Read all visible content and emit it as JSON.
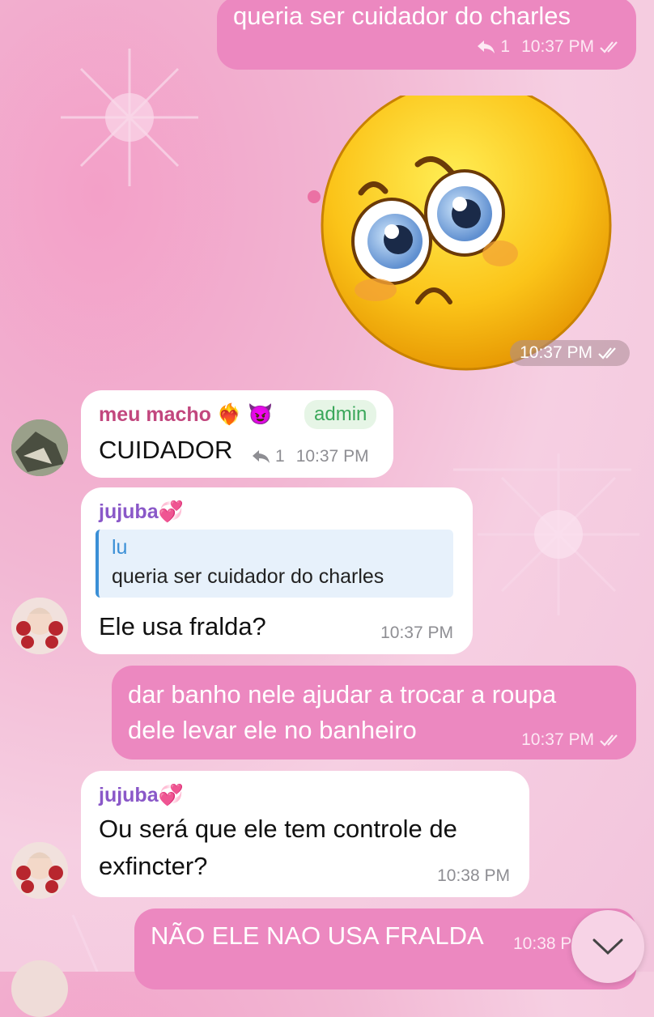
{
  "messages": [
    {
      "id": "m1",
      "text": "queria ser cuidador do charles",
      "replies": "1",
      "time": "10:37 PM"
    },
    {
      "id": "m2",
      "sticker": "pleading-face-sticker",
      "time": "10:37 PM"
    },
    {
      "id": "m3",
      "sender": "meu macho",
      "sender_emoji": "❤️‍🔥 😈",
      "badge": "admin",
      "text": "CUIDADOR",
      "replies": "1",
      "time": "10:37 PM"
    },
    {
      "id": "m4",
      "sender": "jujuba",
      "sender_emoji": "💞",
      "reply_name": "lu",
      "reply_text": "queria ser cuidador do charles",
      "text": "Ele usa fralda?",
      "time": "10:37 PM"
    },
    {
      "id": "m5",
      "text_line1": "dar banho nele ajudar a trocar a roupa",
      "text_line2": "dele levar ele no banheiro",
      "time": "10:37 PM"
    },
    {
      "id": "m6",
      "sender": "jujuba",
      "sender_emoji": "💞",
      "text_line1": "Ou será que ele tem controle de",
      "text_line2": "exfincter?",
      "time": "10:38 PM"
    },
    {
      "id": "m7",
      "text": "NÃO ELE NAO USA FRALDA",
      "time": "10:38 PM"
    }
  ],
  "colors": {
    "outgoing": "#ec88c0",
    "incoming": "#ffffff",
    "sender_meu_macho": "#c2477e",
    "sender_jujuba": "#8a58c8",
    "admin": "#3aa75a",
    "reply_accent": "#3a8fd6"
  },
  "icons": {
    "reply": "reply-arrow-icon",
    "read": "double-check-icon",
    "scroll": "chevron-down-icon"
  }
}
